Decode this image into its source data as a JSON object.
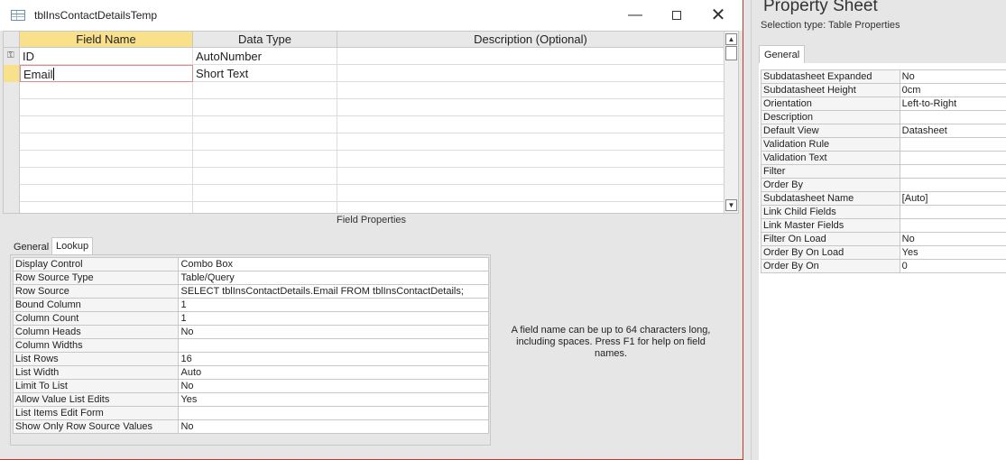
{
  "window": {
    "title": "tblInsContactDetailsTemp"
  },
  "grid": {
    "headers": {
      "field_name": "Field Name",
      "data_type": "Data Type",
      "description": "Description (Optional)"
    },
    "rows": [
      {
        "field_name": "ID",
        "data_type": "AutoNumber",
        "description": ""
      },
      {
        "field_name": "Email",
        "data_type": "Short Text",
        "description": ""
      }
    ]
  },
  "field_properties_label": "Field Properties",
  "lower_tabs": {
    "general": "General",
    "lookup": "Lookup"
  },
  "lookup_props": [
    {
      "name": "Display Control",
      "value": "Combo Box"
    },
    {
      "name": "Row Source Type",
      "value": "Table/Query"
    },
    {
      "name": "Row Source",
      "value": "SELECT tblInsContactDetails.Email FROM tblInsContactDetails;"
    },
    {
      "name": "Bound Column",
      "value": "1"
    },
    {
      "name": "Column Count",
      "value": "1"
    },
    {
      "name": "Column Heads",
      "value": "No"
    },
    {
      "name": "Column Widths",
      "value": ""
    },
    {
      "name": "List Rows",
      "value": "16"
    },
    {
      "name": "List Width",
      "value": "Auto"
    },
    {
      "name": "Limit To List",
      "value": "No"
    },
    {
      "name": "Allow Value List Edits",
      "value": "Yes"
    },
    {
      "name": "List Items Edit Form",
      "value": ""
    },
    {
      "name": "Show Only Row Source Values",
      "value": "No"
    }
  ],
  "help_text": "A field name can be up to 64 characters long, including spaces. Press F1 for help on field names.",
  "property_sheet": {
    "title": "Property Sheet",
    "selection_type": "Selection type:  Table Properties",
    "tab": "General",
    "props": [
      {
        "name": "Subdatasheet Expanded",
        "value": "No"
      },
      {
        "name": "Subdatasheet Height",
        "value": "0cm"
      },
      {
        "name": "Orientation",
        "value": "Left-to-Right"
      },
      {
        "name": "Description",
        "value": ""
      },
      {
        "name": "Default View",
        "value": "Datasheet"
      },
      {
        "name": "Validation Rule",
        "value": ""
      },
      {
        "name": "Validation Text",
        "value": ""
      },
      {
        "name": "Filter",
        "value": ""
      },
      {
        "name": "Order By",
        "value": ""
      },
      {
        "name": "Subdatasheet Name",
        "value": "[Auto]"
      },
      {
        "name": "Link Child Fields",
        "value": ""
      },
      {
        "name": "Link Master Fields",
        "value": ""
      },
      {
        "name": "Filter On Load",
        "value": "No"
      },
      {
        "name": "Order By On Load",
        "value": "Yes"
      },
      {
        "name": "Order By On",
        "value": "0"
      }
    ]
  }
}
